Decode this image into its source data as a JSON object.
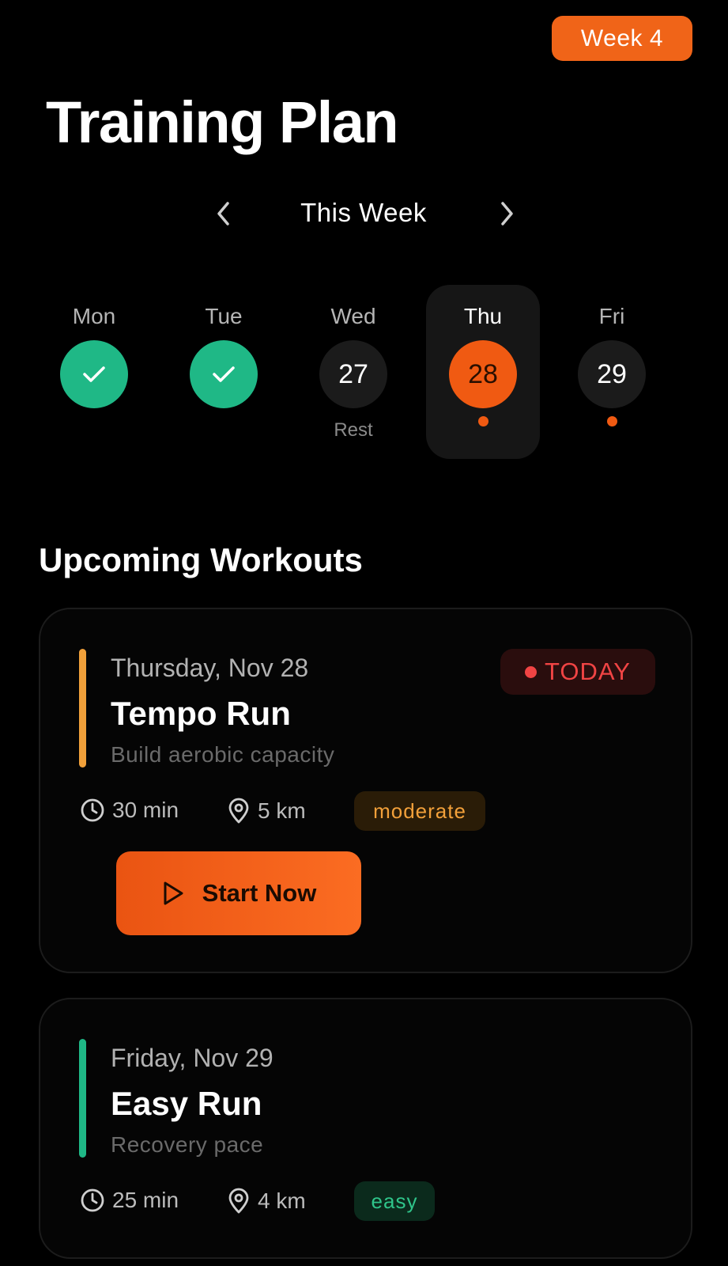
{
  "header": {
    "week_badge": "Week 4",
    "title": "Training Plan"
  },
  "week_nav": {
    "label": "This Week",
    "prev_icon": "chevron-left-icon",
    "next_icon": "chevron-right-icon"
  },
  "days": [
    {
      "name": "Mon",
      "number": "",
      "status": "done",
      "sub": ""
    },
    {
      "name": "Tue",
      "number": "",
      "status": "done",
      "sub": ""
    },
    {
      "name": "Wed",
      "number": "27",
      "status": "rest",
      "sub": "Rest"
    },
    {
      "name": "Thu",
      "number": "28",
      "status": "today",
      "sub": ""
    },
    {
      "name": "Fri",
      "number": "29",
      "status": "planned",
      "sub": ""
    }
  ],
  "section": {
    "title": "Upcoming Workouts"
  },
  "workouts": [
    {
      "date": "Thursday, Nov 28",
      "title": "Tempo Run",
      "subtitle": "Build aerobic capacity",
      "badge": "TODAY",
      "duration": "30 min",
      "distance": "5 km",
      "intensity": "moderate",
      "action_label": "Start Now"
    },
    {
      "date": "Friday, Nov 29",
      "title": "Easy Run",
      "subtitle": "Recovery pace",
      "duration": "25 min",
      "distance": "4 km",
      "intensity": "easy"
    }
  ],
  "colors": {
    "accent": "#f06418",
    "success": "#1fb886",
    "moderate": "#f2a03a",
    "easy": "#2fc48a",
    "alert": "#f04444",
    "background": "#000000"
  }
}
